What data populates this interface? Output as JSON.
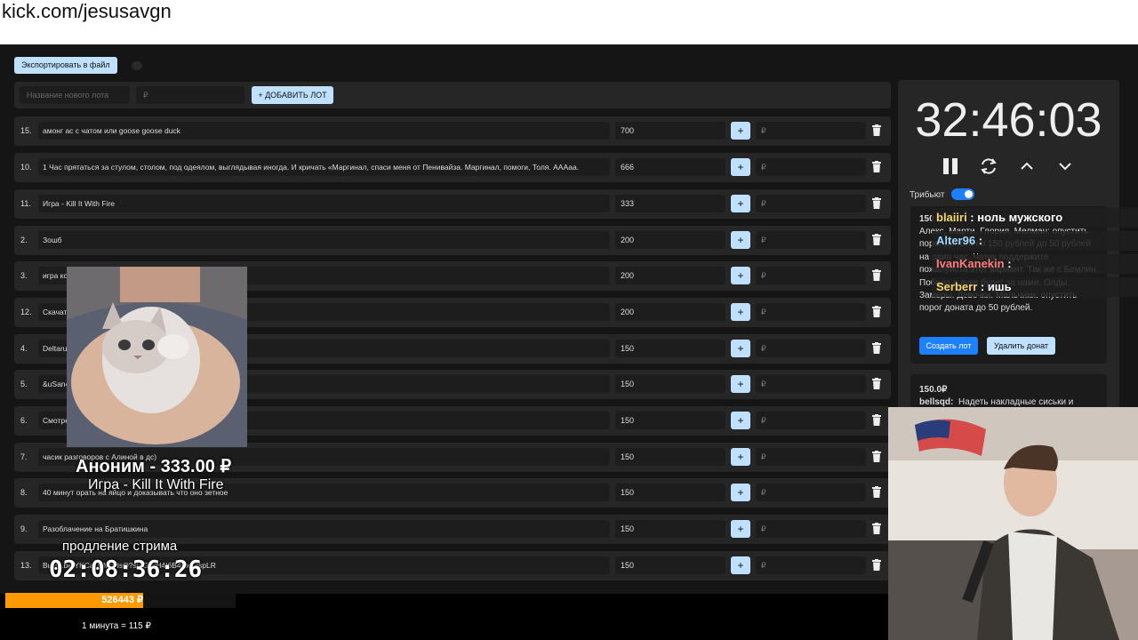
{
  "url": "kick.com/jesusavgn",
  "export_label": "Экспортировать в файл",
  "new_lot": {
    "name_placeholder": "Название нового лота",
    "price_placeholder": "₽",
    "add_label": "+ ДОБАВИТЬ ЛОТ"
  },
  "lots": [
    {
      "num": "15.",
      "title": "амонг ас с чатом или goose goose duck",
      "amount": "700",
      "plus": "+",
      "rub": "₽"
    },
    {
      "num": "10.",
      "title": "1 Час прятаться за стулом, столом, под одеялом, выглядывая иногда. И кричать «Маргинал, спаси меня от Пенивайза. Маргинал, помоги, Толя. АААаа.",
      "amount": "666",
      "plus": "+",
      "rub": "₽"
    },
    {
      "num": "11.",
      "title": "Игра - Kill It With Fire",
      "amount": "333",
      "plus": "+",
      "rub": "₽"
    },
    {
      "num": "2.",
      "title": "Зошб",
      "amount": "200",
      "plus": "+",
      "rub": "₽"
    },
    {
      "num": "3.",
      "title": "игра кот                                                                         ?v=8MJ4E3FbFx4",
      "amount": "200",
      "plus": "+",
      "rub": "₽"
    },
    {
      "num": "12.",
      "title": "Скачат",
      "amount": "200",
      "plus": "+",
      "rub": "₽"
    },
    {
      "num": "4.",
      "title": "Deltarun",
      "amount": "150",
      "plus": "+",
      "rub": "₽"
    },
    {
      "num": "5.",
      "title": "&uSan4                                                                          V_WXxU&ab_channel=uSan4e3",
      "amount": "150",
      "plus": "+",
      "rub": "₽"
    },
    {
      "num": "6.",
      "title": "Смотрет                                                                         pe2mQp1ATN-ql",
      "amount": "150",
      "plus": "+",
      "rub": "₽"
    },
    {
      "num": "7.",
      "title": "часик разговоров с Алиной в дс)",
      "amount": "150",
      "plus": "+",
      "rub": "₽"
    },
    {
      "num": "8.",
      "title": "40 минут орать на яйцо и доказывать что оно зетное",
      "amount": "150",
      "plus": "+",
      "rub": "₽"
    },
    {
      "num": "9.",
      "title": "Разоблачение на Братишкина",
      "amount": "150",
      "plus": "+",
      "rub": "₽"
    },
    {
      "num": "13.",
      "title": "Вы                                                      tu.be/YKCaUzMgHsQ?si=GWH4I6B4Bx72spLR",
      "amount": "150",
      "plus": "+",
      "rub": "₽"
    }
  ],
  "timer": "32:46:03",
  "tribute_label": "Трибьют",
  "donation_card": {
    "amount": "150",
    "text": "Алекс, Марти, Глория, Мелман: опустить порог доната со 150 рублей до 50 рублей на один час. Чатик поддержите пожалуйста этот вариант. Так же с Бемлин. Победа в ауке будет за нами. Олды. Замеры. Девочки. Мальчики. опустить порог доната до 50 рублей.",
    "create_label": "Создать лот",
    "delete_label": "Удалить донат"
  },
  "donation_card2": {
    "amount": "150.0₽",
    "user": "bellsqd:",
    "text": "Надеть накладные сиськи и"
  },
  "chat": [
    {
      "user": "blaiiri",
      "sep": " : ",
      "msg": "ноль мужского",
      "color": "#f5d76e"
    },
    {
      "user": "Alter96",
      "sep": " : ",
      "msg": "",
      "color": "#9fd6ff"
    },
    {
      "user": "IvanKanekin",
      "sep": " : ",
      "msg": "",
      "color": "#ff7b7b"
    },
    {
      "user": "Serberr",
      "sep": " : ",
      "msg": "ишь",
      "color": "#f5d76e"
    }
  ],
  "overlay": {
    "donor": "Аноним - 333.00 ₽",
    "game": "Игра - Kill It With Fire",
    "extend_label": "продление стрима",
    "countdown": "02:08:36:26",
    "progress_value": "526443 ₽",
    "progress_fraction": 0.6,
    "rate": "1 минута = 115 ₽"
  },
  "colors": {
    "accent": "#1e7fff",
    "button_light": "#bfe1ff",
    "progress": "#ff9900"
  }
}
